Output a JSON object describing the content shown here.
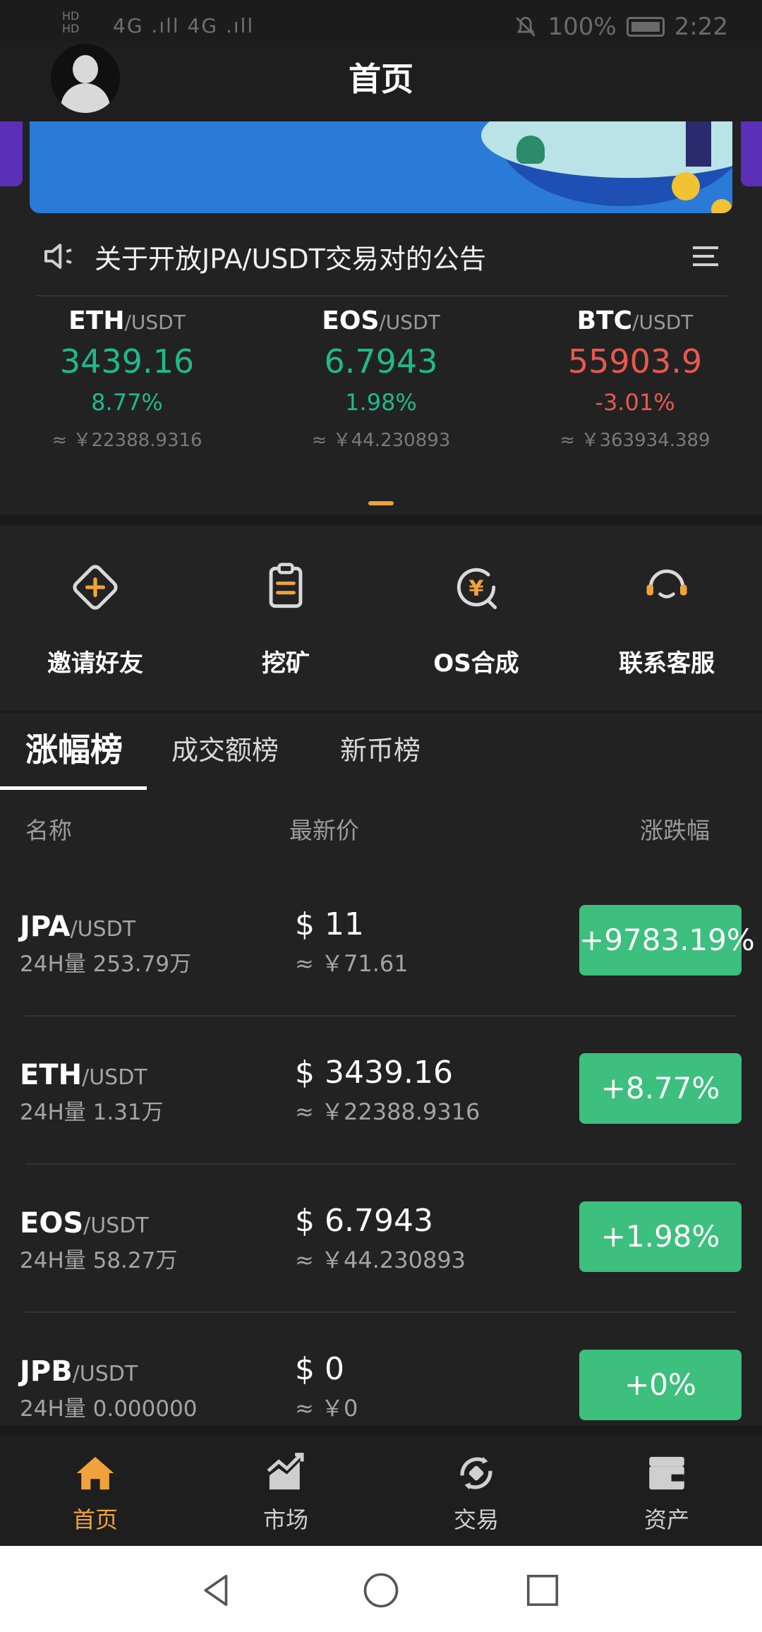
{
  "status_bar": {
    "left_top": "HD",
    "left_bottom": "HD",
    "signal": "4G .ıll 4G .ıll",
    "battery": "100%",
    "time": "2:22"
  },
  "header": {
    "title": "首页"
  },
  "notice": {
    "text": "关于开放JPA/USDT交易对的公告"
  },
  "tickers": [
    {
      "base": "ETH",
      "quote": "/USDT",
      "price": "3439.16",
      "change": "8.77%",
      "cny": "≈ ￥22388.9316",
      "direction": "up"
    },
    {
      "base": "EOS",
      "quote": "/USDT",
      "price": "6.7943",
      "change": "1.98%",
      "cny": "≈ ￥44.230893",
      "direction": "up"
    },
    {
      "base": "BTC",
      "quote": "/USDT",
      "price": "55903.9",
      "change": "-3.01%",
      "cny": "≈ ￥363934.389",
      "direction": "down"
    }
  ],
  "actions": [
    {
      "label": "邀请好友",
      "icon": "invite-icon"
    },
    {
      "label": "挖矿",
      "icon": "mining-icon"
    },
    {
      "label": "OS合成",
      "icon": "synthesis-icon"
    },
    {
      "label": "联系客服",
      "icon": "support-icon"
    }
  ],
  "tabs": [
    "涨幅榜",
    "成交额榜",
    "新币榜"
  ],
  "list_header": {
    "name": "名称",
    "price": "最新价",
    "change": "涨跌幅"
  },
  "rows": [
    {
      "base": "JPA",
      "quote": "/USDT",
      "volume": "24H量  253.79万",
      "usd": "$ 11",
      "cny": "≈  ￥71.61",
      "change": "+9783.19%"
    },
    {
      "base": "ETH",
      "quote": "/USDT",
      "volume": "24H量  1.31万",
      "usd": "$ 3439.16",
      "cny": "≈  ￥22388.9316",
      "change": "+8.77%"
    },
    {
      "base": "EOS",
      "quote": "/USDT",
      "volume": "24H量  58.27万",
      "usd": "$ 6.7943",
      "cny": "≈  ￥44.230893",
      "change": "+1.98%"
    },
    {
      "base": "JPB",
      "quote": "/USDT",
      "volume": "24H量  0.000000",
      "usd": "$ 0",
      "cny": "≈  ￥0",
      "change": "+0%"
    }
  ],
  "bottom_nav": [
    {
      "label": "首页",
      "icon": "home-icon",
      "active": true
    },
    {
      "label": "市场",
      "icon": "market-icon",
      "active": false
    },
    {
      "label": "交易",
      "icon": "trade-icon",
      "active": false
    },
    {
      "label": "资产",
      "icon": "wallet-icon",
      "active": false
    }
  ],
  "colors": {
    "up": "#20b98a",
    "down": "#e8584f",
    "accent": "#f0a23c",
    "badge_green": "#3dbf7e",
    "background": "#222222"
  }
}
